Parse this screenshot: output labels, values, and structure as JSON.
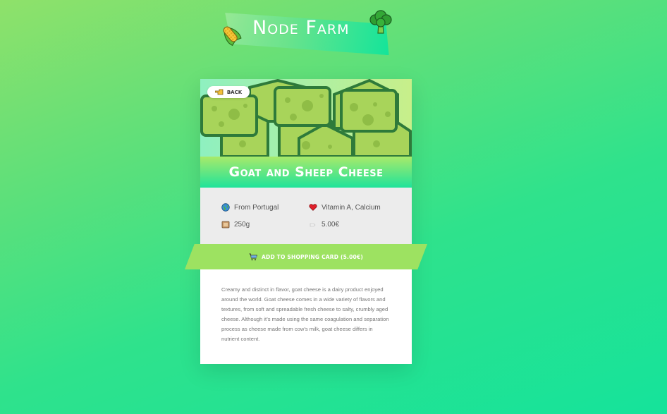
{
  "header": {
    "title": "Node Farm",
    "left_icon": "corn-icon",
    "right_icon": "broccoli-icon"
  },
  "product": {
    "name": "Goat and Sheep Cheese",
    "image_icon": "cheese-icon",
    "back_label": "BACK",
    "origin": "From Portugal",
    "nutrients": "Vitamin A, Calcium",
    "quantity": "250g",
    "price": "5.00€",
    "add_to_cart_label": "ADD TO SHOPPING CARD (5.00€)",
    "description": "Creamy and distinct in flavor, goat cheese is a dairy product enjoyed around the world. Goat cheese comes in a wide variety of flavors and textures, from soft and spreadable fresh cheese to salty, crumbly aged cheese. Although it’s made using the same coagulation and separation process as cheese made from cow’s milk, goat cheese differs in nutrient content."
  },
  "colors": {
    "accent_green": "#9de261",
    "title_gradient_end": "#1fe39a",
    "info_background": "#ececec"
  }
}
